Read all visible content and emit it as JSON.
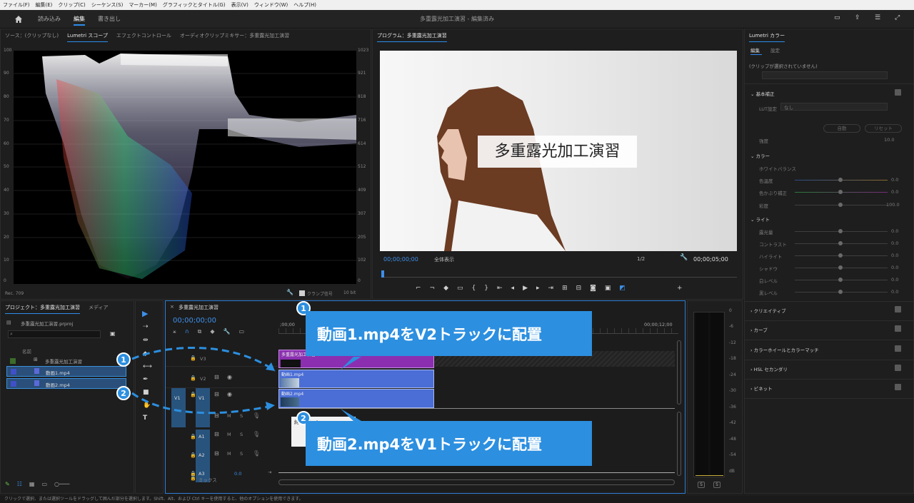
{
  "menu": [
    "ファイル(F)",
    "編集(E)",
    "クリップ(C)",
    "シーケンス(S)",
    "マーカー(M)",
    "グラフィックとタイトル(G)",
    "表示(V)",
    "ウィンドウ(W)",
    "ヘルプ(H)"
  ],
  "workspaces": {
    "import": "読み込み",
    "edit": "編集",
    "export": "書き出し"
  },
  "window_title": "多重露光加工演習 - 編集済み",
  "source_panel": {
    "tabs": [
      "ソース：(クリップなし)",
      "Lumetri スコープ",
      "エフェクトコントロール",
      "オーディオクリップミキサー：多重露光加工演習"
    ],
    "left_axis": [
      "100",
      "90",
      "80",
      "70",
      "60",
      "50",
      "40",
      "30",
      "20",
      "10",
      "0"
    ],
    "right_axis": [
      "1023",
      "921",
      "818",
      "716",
      "614",
      "512",
      "409",
      "307",
      "205",
      "102",
      "0"
    ],
    "corner_label": "Rec. 709",
    "clamp_label": "クランプ信号",
    "bits_label": "10 bit"
  },
  "program": {
    "title": "プログラム：多重露光加工演習",
    "overlay_text": "多重露光加工演習",
    "timecode_left": "00;00;00;00",
    "fit_label": "全体表示",
    "quality": "1/2",
    "timecode_right": "00;00;05;00"
  },
  "project": {
    "title": "プロジェクト：多重露光加工演習",
    "tab2": "メディア",
    "file": "多重露光加工演習.prproj",
    "col_name": "名前",
    "items": [
      "多重露光加工演習",
      "動画1.mp4",
      "動画2.mp4"
    ]
  },
  "timeline": {
    "title": "多重露光加工演習",
    "timecode": "00;00;00;00",
    "ruler_left": ";00;00",
    "ruler_right": "00;00;12;00",
    "tracks_video": [
      "V3",
      "V2",
      "V1"
    ],
    "tracks_audio": [
      "A1",
      "A2",
      "A3"
    ],
    "src_patch": "V1",
    "mix_label": "ミックス",
    "mix_value": "0.0",
    "clip_v2": "動画1.mp4",
    "clip_v1": "動画2.mp4",
    "clip_v3": "多重露光加工演習",
    "tooltip_fragment": "終了 デュレ"
  },
  "callouts": {
    "c1": "動画1.mp4をV2トラックに配置",
    "c2": "動画2.mp4をV1トラックに配置",
    "n1": "1",
    "n2": "2"
  },
  "meter_scale": [
    "0",
    "-6",
    "-12",
    "-18",
    "-24",
    "-30",
    "-36",
    "-42",
    "-48",
    "-54",
    "dB"
  ],
  "lumetri": {
    "title": "Lumetri カラー",
    "tabs": [
      "編集",
      "設定"
    ],
    "no_clip": "(クリップが選択されていません)",
    "basic": "基本補正",
    "lut_label": "LUT設定",
    "lut_value": "なし",
    "intensity": "強度",
    "intensity_val": "10.0",
    "auto_btn": "自動",
    "reset_btn": "リセット",
    "color": "カラー",
    "wb": "ホワイトバランス",
    "temp": "色温度",
    "tint": "色かぶり補正",
    "sat": "彩度",
    "sat_val": "100.0",
    "light": "ライト",
    "light_items": [
      "露光量",
      "コントラスト",
      "ハイライト",
      "シャドウ",
      "白レベル",
      "黒レベル"
    ],
    "zero": "0.0",
    "sections": [
      "クリエイティブ",
      "カーブ",
      "カラーホイールとカラーマッチ",
      "HSL セカンダリ",
      "ビネット"
    ]
  },
  "status": "クリックで選択、または選択ツールをドラッグして囲んだ部分を選択します。Shift、Alt、および Ctrl キーを使用すると、他のオプションを使用できます。",
  "colors": {
    "accent": "#2c8fe0",
    "clip": "#4b6ed6",
    "title_clip": "#8b2fb0"
  }
}
